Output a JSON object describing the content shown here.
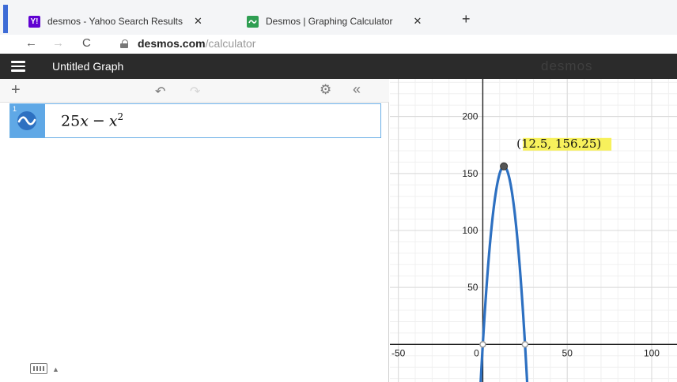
{
  "browser": {
    "tabs": [
      {
        "label": "desmos - Yahoo Search Results",
        "close": "✕",
        "favicon": "yahoo-icon",
        "favicon_color": "#6001d2"
      },
      {
        "label": "Desmos | Graphing Calculator",
        "close": "✕",
        "favicon": "desmos-icon",
        "favicon_color": "#2f9e52"
      }
    ],
    "new_tab": "+",
    "nav": {
      "back": "←",
      "forward": "→",
      "reload": "C"
    },
    "url_host": "desmos.com",
    "url_path": "/calculator"
  },
  "header": {
    "title": "Untitled Graph",
    "brand": "desmos",
    "background": "#2b2b2b"
  },
  "toolbar": {
    "add": "+",
    "undo": "↶",
    "redo": "↷",
    "settings": "⚙",
    "collapse": "«"
  },
  "expressions": [
    {
      "number": "1",
      "coefficient": "25",
      "var": "x",
      "op": "−",
      "var2": "x",
      "exponent": "2",
      "color": "#2d70c1"
    }
  ],
  "graph": {
    "point_label": "(12.5, 156.25)",
    "label_highlight": "#f6f04a",
    "curve_color": "#2d70c1"
  },
  "chart_data": {
    "type": "line",
    "xlim": [
      -55,
      115
    ],
    "ylim": [
      -33,
      233
    ],
    "x_ticks": [
      -50,
      0,
      50,
      100
    ],
    "x_tick_labels": [
      "-50",
      "0",
      "50",
      "100"
    ],
    "y_ticks": [
      50,
      100,
      150,
      200
    ],
    "y_tick_labels": [
      "50",
      "100",
      "150",
      "200"
    ],
    "grid": true,
    "function": "25x - x^2",
    "series": [
      {
        "x": [
          -1.5,
          0,
          2,
          4,
          6,
          8,
          10,
          12.5,
          15,
          17,
          19,
          21,
          23,
          25,
          26.5
        ],
        "y": [
          -39.75,
          0,
          46,
          84,
          114,
          136,
          150,
          156.25,
          150,
          136,
          114,
          84,
          46,
          0,
          -39.75
        ]
      }
    ],
    "highlight_point": {
      "x": 12.5,
      "y": 156.25
    },
    "zero_points": [
      {
        "x": 0,
        "y": 0
      },
      {
        "x": 25,
        "y": 0
      }
    ]
  }
}
